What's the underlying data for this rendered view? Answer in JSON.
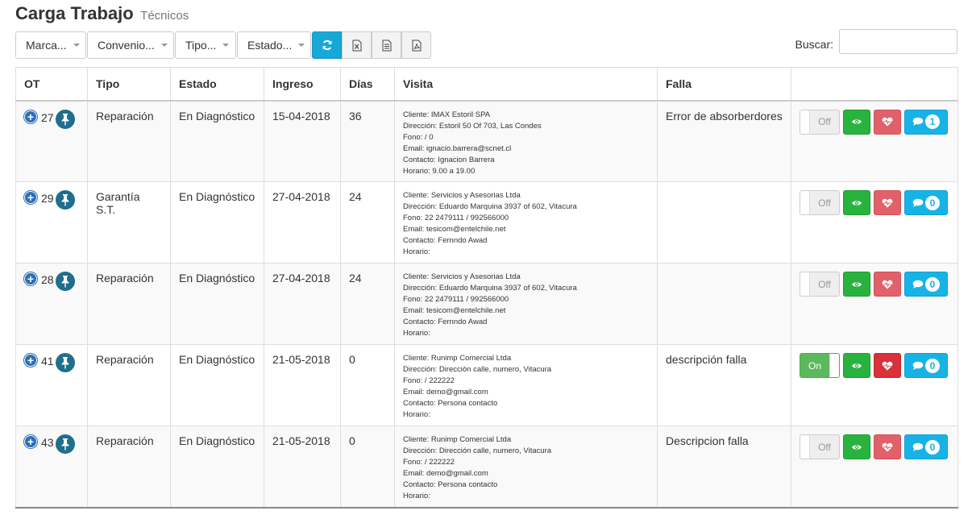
{
  "header": {
    "title": "Carga Trabajo",
    "subtitle": "Técnicos"
  },
  "filters": [
    {
      "label": "Marca..."
    },
    {
      "label": "Convenio..."
    },
    {
      "label": "Tipo..."
    },
    {
      "label": "Estado..."
    }
  ],
  "toolbar_icons": [
    "refresh-icon",
    "excel-icon",
    "document-icon",
    "pdf-icon"
  ],
  "search": {
    "label": "Buscar:",
    "value": "",
    "placeholder": ""
  },
  "table": {
    "columns": [
      "OT",
      "Tipo",
      "Estado",
      "Ingreso",
      "Días",
      "Visita",
      "Falla",
      ""
    ],
    "rows": [
      {
        "ot": "27",
        "tipo": "Reparación",
        "estado": "En Diagnóstico",
        "ingreso": "15-04-2018",
        "dias": "36",
        "visita": [
          "Cliente: IMAX Estoril SPA",
          "Dirección: Estoril 50 Of 703, Las Condes",
          "Fono: / 0",
          "Email: ignacio.barrera@scnet.cl",
          "Contacto: Ignacion Barrera",
          "Horario: 9.00 a 19.00"
        ],
        "falla": "Error de absorberdores",
        "toggle": "Off",
        "comments": "1"
      },
      {
        "ot": "29",
        "tipo": "Garantía S.T.",
        "estado": "En Diagnóstico",
        "ingreso": "27-04-2018",
        "dias": "24",
        "visita": [
          "Cliente: Servicios y Asesorias Ltda",
          "Dirección: Eduardo Marquina 3937 of 602, Vitacura",
          "Fono: 22 2479111 / 992566000",
          "Email: tesicom@entelchile.net",
          "Contacto: Fernndo Awad",
          "Horario:"
        ],
        "falla": "",
        "toggle": "Off",
        "comments": "0"
      },
      {
        "ot": "28",
        "tipo": "Reparación",
        "estado": "En Diagnóstico",
        "ingreso": "27-04-2018",
        "dias": "24",
        "visita": [
          "Cliente: Servicios y Asesorias Ltda",
          "Dirección: Eduardo Marquina 3937 of 602, Vitacura",
          "Fono: 22 2479111 / 992566000",
          "Email: tesicom@entelchile.net",
          "Contacto: Fernndo Awad",
          "Horario:"
        ],
        "falla": "",
        "toggle": "Off",
        "comments": "0"
      },
      {
        "ot": "41",
        "tipo": "Reparación",
        "estado": "En Diagnóstico",
        "ingreso": "21-05-2018",
        "dias": "0",
        "visita": [
          "Cliente: Runimp Comercial Ltda",
          "Dirección: Dirección calle, numero, Vitacura",
          "Fono: / 222222",
          "Email: demo@gmail.com",
          "Contacto: Persona contacto",
          "Horario:"
        ],
        "falla": "descripción falla",
        "toggle": "On",
        "comments": "0"
      },
      {
        "ot": "43",
        "tipo": "Reparación",
        "estado": "En Diagnóstico",
        "ingreso": "21-05-2018",
        "dias": "0",
        "visita": [
          "Cliente: Runimp Comercial Ltda",
          "Dirección: Dirección calle, numero, Vitacura",
          "Fono: / 222222",
          "Email: demo@gmail.com",
          "Contacto: Persona contacto",
          "Horario:"
        ],
        "falla": "Descripcion falla",
        "toggle": "Off",
        "comments": "0"
      }
    ]
  },
  "colors": {
    "refresh": "#17a8d8",
    "view": "#28b33e",
    "health": "#e0616a",
    "chat": "#17b3e6",
    "toggle_on": "#5cb85c",
    "pin": "#1f6e8c",
    "plus": "#2d6fb7"
  }
}
